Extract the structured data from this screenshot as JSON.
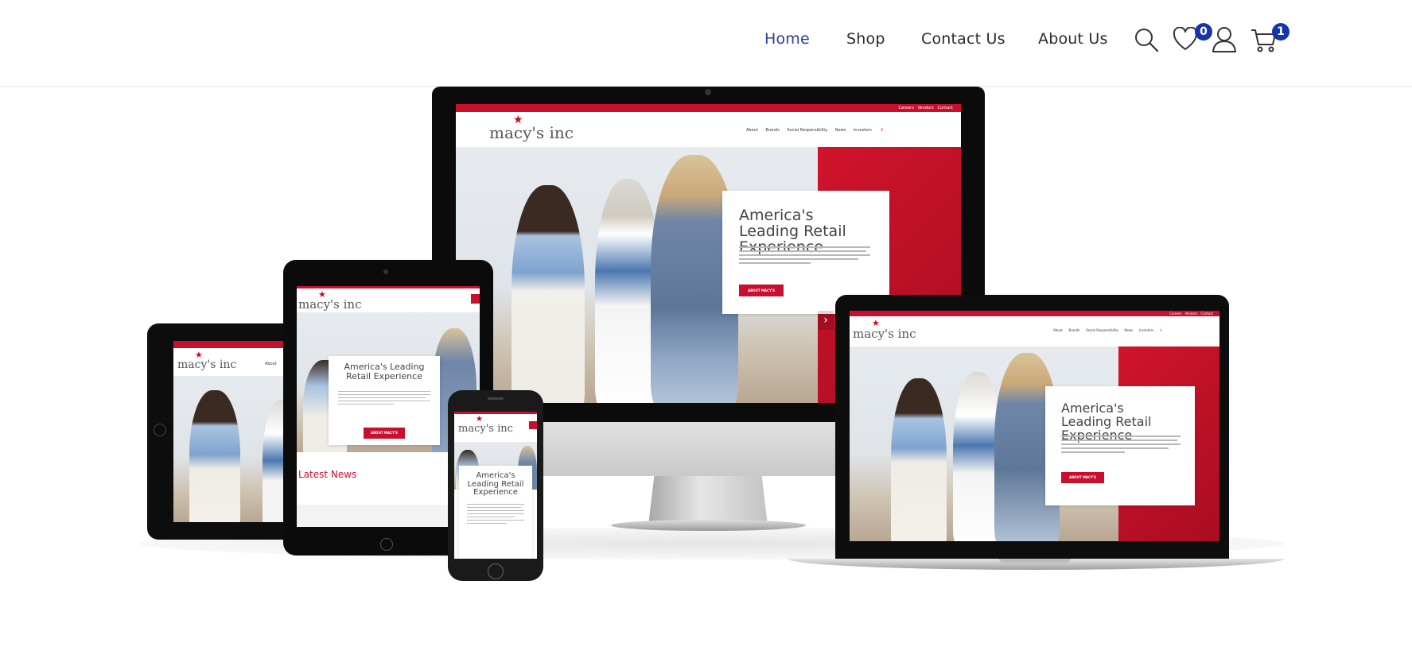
{
  "nav": {
    "items": [
      {
        "label": "Home",
        "active": true
      },
      {
        "label": "Shop",
        "active": false
      },
      {
        "label": "Contact Us",
        "active": false
      },
      {
        "label": "About Us",
        "active": false
      }
    ],
    "wishlist_count": "0",
    "cart_count": "1",
    "icons": [
      "search-icon",
      "heart-icon",
      "user-icon",
      "cart-icon"
    ],
    "accent_color": "#2a3f9e",
    "badge_color": "#1736a6"
  },
  "showcase": {
    "site_logo": "macy's inc",
    "hero_heading": "America's Leading Retail Experience",
    "cta_label": "ABOUT MACY'S",
    "menu_items": [
      "About",
      "Brands",
      "Social Responsibility",
      "News",
      "Investors"
    ],
    "util_links": [
      "Careers",
      "Vendors",
      "Contact"
    ],
    "latest_news": "Latest News",
    "brand_color": "#c8102e"
  }
}
